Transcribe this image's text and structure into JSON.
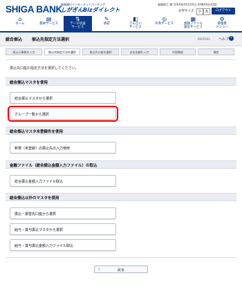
{
  "header": {
    "logo": "SHIGA BANK",
    "tagline_top": "滋賀銀行インターネットバンキング",
    "brand": "しがぎんBizダイレクト",
    "user_info": "滋賀商工 様  20XX年XX月XX日 XX時XX分XX秒",
    "font_size_label": "文字サイズ",
    "font_small": "小",
    "font_large": "大",
    "logout_label": "ログアウト"
  },
  "nav": {
    "items": [
      {
        "label": "ホーム",
        "icon": "home-icon",
        "glyph": "⌂"
      },
      {
        "label": "基本サービス",
        "icon": "document-icon",
        "glyph": "▤"
      },
      {
        "label": "データ伝送\nサービス",
        "icon": "data-transfer-icon",
        "glyph": "⇅"
      },
      {
        "label": "承認",
        "icon": "approval-icon",
        "glyph": "✎"
      },
      {
        "label": "でんさい\nサービス",
        "icon": "densai-icon",
        "glyph": "◧"
      },
      {
        "label": "外為サービス",
        "icon": "foreign-exchange-icon",
        "glyph": "◎"
      },
      {
        "label": "金融ファイル\n送信サービス",
        "icon": "file-send-icon",
        "glyph": "▦"
      },
      {
        "label": "管理者\nメニュー",
        "icon": "admin-icon",
        "glyph": "⚙"
      }
    ]
  },
  "titlebar": {
    "category": "総合振込",
    "title": "振込先指定方法選択",
    "page_id": "BSSF003",
    "help": "ヘルプ"
  },
  "steps": [
    "振込元情報を入力",
    "振込先指定方法を選択",
    "振込先口座を選択",
    "支払金額を入力",
    "内容確認",
    "確定"
  ],
  "intro": "振込先口座の指定方法を選択してください。",
  "sections": {
    "master": {
      "title": "総合振込マスタを使用",
      "buttons": [
        "総合振込マスタから選択",
        "グループ一覧から選択"
      ]
    },
    "unregistered": {
      "title": "総合振込マスタ未登録先を使用",
      "buttons": [
        "新規（未登録）の振込先の入力使用"
      ]
    },
    "file": {
      "title": "金融ファイル（総合振込金額入力ファイル）の取込",
      "buttons": [
        "総合振込金額入力ファイル取込"
      ]
    },
    "other": {
      "title": "総合振込以外のマスタを使用",
      "buttons": [
        "振込・振替先口座から選択",
        "給与・賞与振込マスタから選択",
        "給与・賞与振込金額入力ファイル取込"
      ]
    }
  },
  "back_label": "戻る",
  "colors": {
    "brand": "#0b3a8a",
    "highlight": "#ee0000"
  }
}
